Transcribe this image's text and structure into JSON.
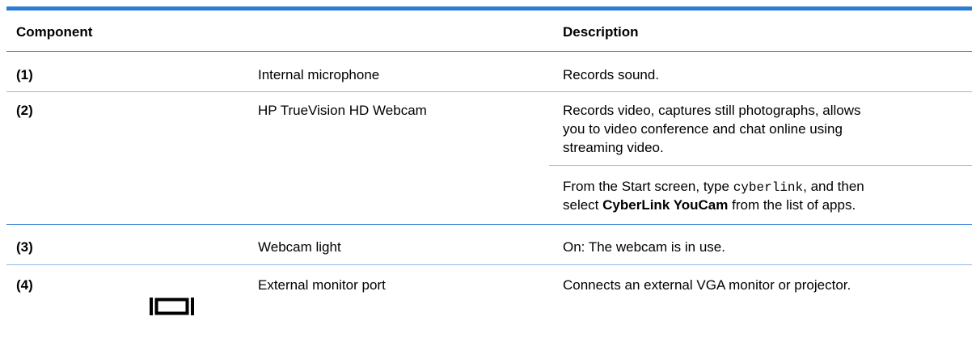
{
  "header": {
    "component": "Component",
    "description": "Description"
  },
  "rows": [
    {
      "num": "(1)",
      "name": "Internal microphone",
      "desc": "Records sound."
    },
    {
      "num": "(2)",
      "name": "HP TrueVision HD Webcam",
      "desc_lines": [
        "Records video, captures still photographs, allows",
        "you to video conference and chat online using",
        "streaming video."
      ],
      "desc2_prefix": "From the Start screen, type ",
      "desc2_code": "cyberlink",
      "desc2_mid": ", and then",
      "desc2_line2_prefix": "select ",
      "desc2_bold": "CyberLink YouCam",
      "desc2_line2_suffix": " from the list of apps."
    },
    {
      "num": "(3)",
      "name": "Webcam light",
      "desc": "On: The webcam is in use."
    },
    {
      "num": "(4)",
      "name": "External monitor port",
      "desc": "Connects an external VGA monitor or projector.",
      "icon": "vga-port-icon"
    }
  ],
  "colors": {
    "rule": "#2c7bd4",
    "rule_light": "#8fb8e6"
  }
}
